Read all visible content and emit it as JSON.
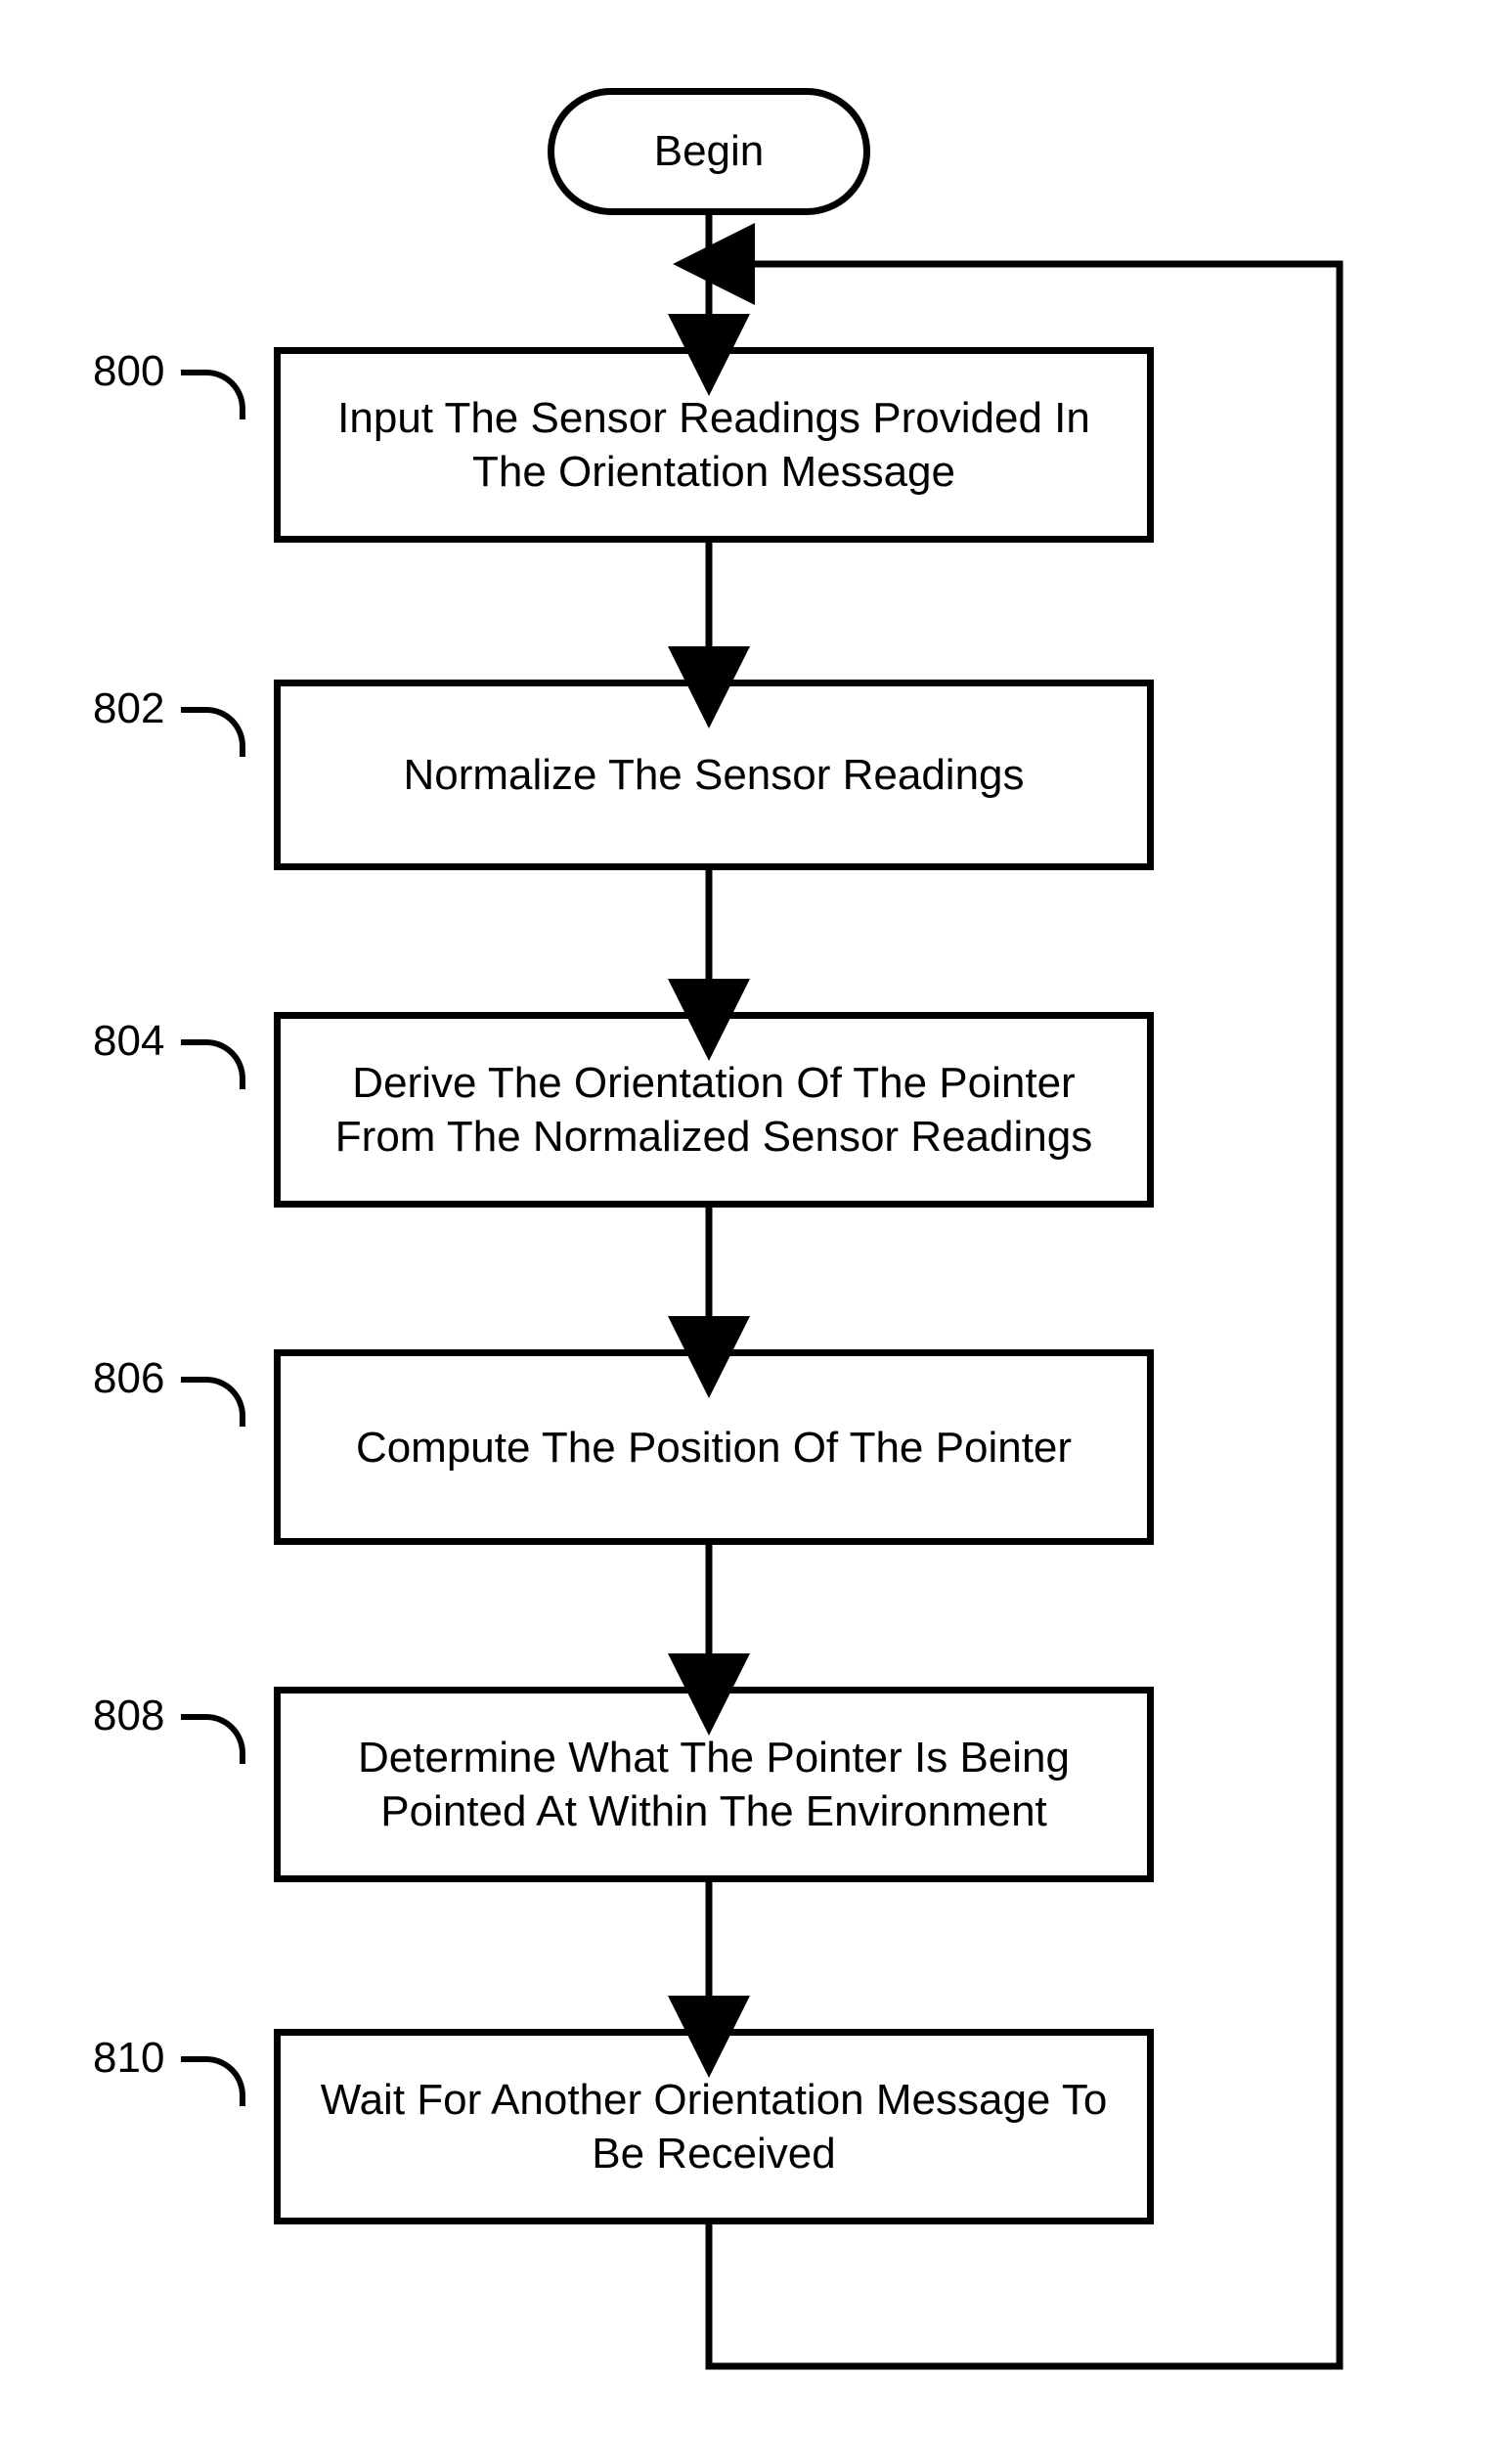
{
  "chart_data": {
    "type": "flowchart",
    "title": "",
    "nodes": [
      {
        "id": "begin",
        "type": "terminator",
        "text": "Begin"
      },
      {
        "id": "800",
        "type": "process",
        "label": "800",
        "text": "Input The Sensor Readings Provided In The Orientation Message"
      },
      {
        "id": "802",
        "type": "process",
        "label": "802",
        "text": "Normalize The Sensor Readings"
      },
      {
        "id": "804",
        "type": "process",
        "label": "804",
        "text": "Derive The Orientation Of The Pointer From The Normalized Sensor Readings"
      },
      {
        "id": "806",
        "type": "process",
        "label": "806",
        "text": "Compute The Position Of The Pointer"
      },
      {
        "id": "808",
        "type": "process",
        "label": "808",
        "text": "Determine What The Pointer Is Being Pointed At Within The Environment"
      },
      {
        "id": "810",
        "type": "process",
        "label": "810",
        "text": "Wait For Another Orientation Message To Be Received"
      }
    ],
    "edges": [
      {
        "from": "begin",
        "to": "800"
      },
      {
        "from": "800",
        "to": "802"
      },
      {
        "from": "802",
        "to": "804"
      },
      {
        "from": "804",
        "to": "806"
      },
      {
        "from": "806",
        "to": "808"
      },
      {
        "from": "808",
        "to": "810"
      },
      {
        "from": "810",
        "to": "begin",
        "type": "loop-back"
      }
    ]
  },
  "begin": {
    "text": "Begin"
  },
  "box800": {
    "label": "800",
    "text": "Input The Sensor Readings Provided In The Orientation Message"
  },
  "box802": {
    "label": "802",
    "text": "Normalize The Sensor Readings"
  },
  "box804": {
    "label": "804",
    "text": "Derive The Orientation Of The Pointer From The Normalized Sensor Readings"
  },
  "box806": {
    "label": "806",
    "text": "Compute The Position Of The Pointer"
  },
  "box808": {
    "label": "808",
    "text": "Determine What The Pointer Is Being Pointed At Within The Environment"
  },
  "box810": {
    "label": "810",
    "text": "Wait For Another Orientation Message To Be Received"
  }
}
